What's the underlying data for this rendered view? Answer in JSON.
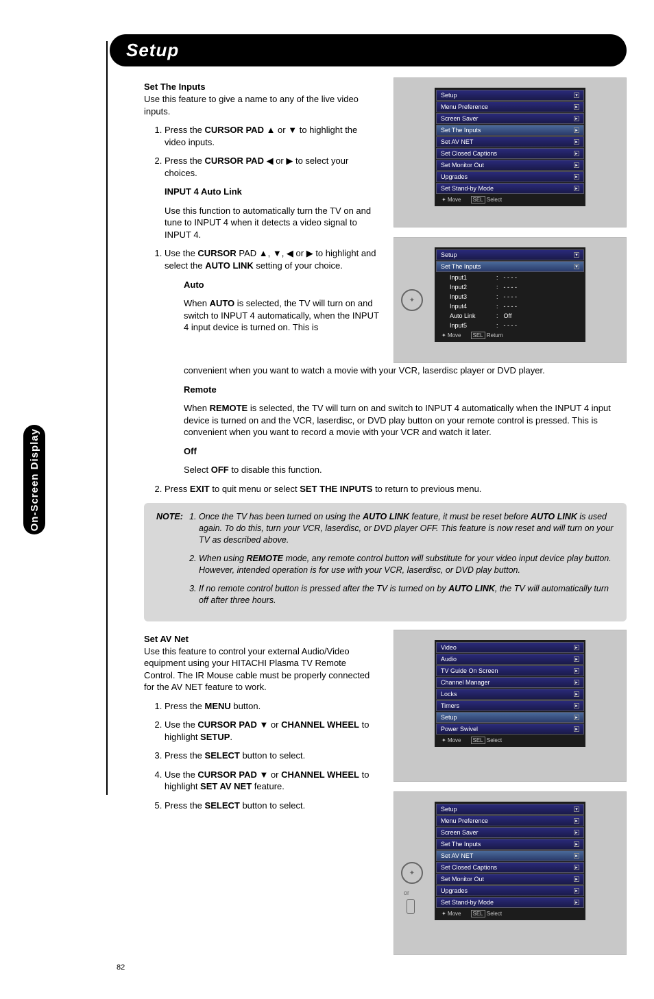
{
  "tab": "On-Screen Display",
  "title": "Setup",
  "page_number": "82",
  "s1": {
    "heading": "Set The Inputs",
    "intro": "Use this feature to give a name to any of the live video inputs.",
    "step1a": "Press the ",
    "step1b": "CURSOR PAD",
    "step1c": " ▲ or ▼ to highlight the video inputs.",
    "step2a": "Press the ",
    "step2b": "CURSOR PAD",
    "step2c": " ◀ or ▶ to select your choices.",
    "sub_heading": "INPUT 4 Auto Link",
    "sub_intro": "Use this function to automatically turn the TV on and tune to INPUT 4 when it detects a video signal to INPUT 4.",
    "sub_step1a": "Use the ",
    "sub_step1b": "CURSOR",
    "sub_step1c": " PAD ▲, ▼, ◀ or ▶ to highlight and select the ",
    "sub_step1d": "AUTO LINK",
    "sub_step1e": " setting of your choice.",
    "auto_h": "Auto",
    "auto_a": "When ",
    "auto_b": "AUTO",
    "auto_c": " is selected, the TV will turn on and switch to INPUT 4 automatically, when the INPUT 4 input device is turned on. This is",
    "auto_tail": "convenient when you want to watch a movie with your VCR, laserdisc player or DVD player.",
    "remote_h": "Remote",
    "remote_a": "When ",
    "remote_b": "REMOTE",
    "remote_c": " is selected, the TV will turn on and switch to INPUT 4 automatically when the INPUT 4 input device is turned on and the VCR, laserdisc, or DVD play button on your remote control is pressed. This is convenient when you want to record a movie with your VCR and watch it later.",
    "off_h": "Off",
    "off_a": "Select ",
    "off_b": "OFF",
    "off_c": " to disable this function.",
    "exit_a": "Press ",
    "exit_b": "EXIT",
    "exit_c": " to quit menu or select ",
    "exit_d": "SET THE INPUTS",
    "exit_e": " to return to previous menu."
  },
  "note": {
    "label": "NOTE:",
    "n1a": "Once the TV has been turned on using the ",
    "n1b": "AUTO LINK",
    "n1c": " feature, it must be reset before ",
    "n1d": "AUTO LINK",
    "n1e": " is used again. To do this, turn your VCR, laserdisc, or DVD player OFF. This feature is now reset and will turn on your TV as described above.",
    "n2a": "When using ",
    "n2b": "REMOTE",
    "n2c": " mode, any remote control button will substitute for your video input device play button. However, intended operation is for use with your VCR, laserdisc, or DVD play button.",
    "n3a": "If no remote control button is pressed after the TV is turned on by ",
    "n3b": "AUTO LINK",
    "n3c": ", the TV will automatically turn off after three hours."
  },
  "s2": {
    "heading": "Set AV Net",
    "intro": "Use this feature to control your external Audio/Video equipment using your HITACHI Plasma TV Remote Control.  The IR Mouse cable must be properly connected for the AV NET feature to work.",
    "st1a": "Press the ",
    "st1b": "MENU",
    "st1c": " button.",
    "st2a": "Use the ",
    "st2b": "CURSOR PAD",
    "st2c": " ▼ or ",
    "st2d": "CHANNEL WHEEL",
    "st2e": " to highlight ",
    "st2f": "SETUP",
    "st2g": ".",
    "st3a": "Press the ",
    "st3b": "SELECT",
    "st3c": " button to select.",
    "st4a": "Use the ",
    "st4b": "CURSOR PAD",
    "st4c": " ▼ or ",
    "st4d": "CHANNEL WHEEL",
    "st4e": " to highlight ",
    "st4f": "SET AV NET",
    "st4g": " feature.",
    "st5a": "Press the ",
    "st5b": "SELECT",
    "st5c": " button to select."
  },
  "osd": {
    "setup": "Setup",
    "items1": [
      "Menu Preference",
      "Screen Saver",
      "Set The Inputs",
      "Set AV NET",
      "Set Closed Captions",
      "Set Monitor Out",
      "Upgrades",
      "Set Stand-by Mode"
    ],
    "foot_move": "Move",
    "foot_sel": "Select",
    "foot_ret": "Return",
    "sel_lbl": "SEL",
    "inputs_head": "Set The Inputs",
    "inputs": [
      {
        "l": "Input1",
        "v": "- - - -"
      },
      {
        "l": "Input2",
        "v": "- - - -"
      },
      {
        "l": "Input3",
        "v": "- - - -"
      },
      {
        "l": "Input4",
        "v": "- - - -"
      },
      {
        "l": "Auto Link",
        "v": "Off"
      },
      {
        "l": "Input5",
        "v": "- - - -"
      }
    ],
    "mainmenu": [
      "Video",
      "Audio",
      "TV Guide On Screen",
      "Channel Manager",
      "Locks",
      "Timers",
      "Setup",
      "Power Swivel"
    ]
  }
}
